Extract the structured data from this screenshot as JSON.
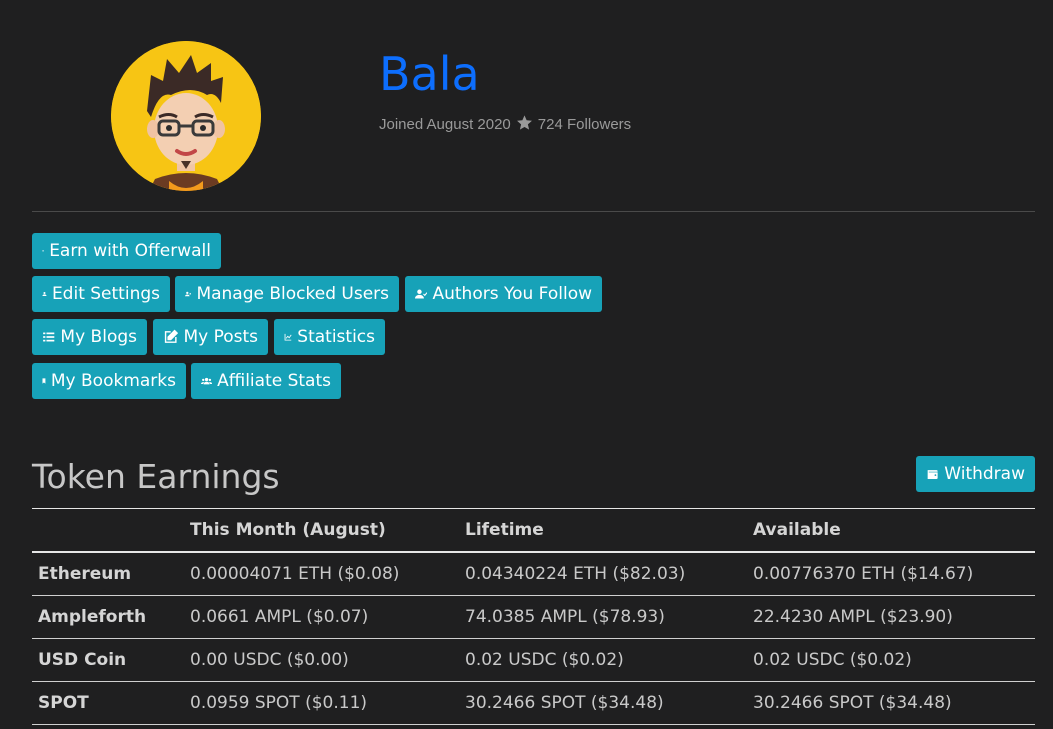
{
  "profile": {
    "name": "Bala",
    "joined": "Joined August 2020",
    "followers": "724 Followers"
  },
  "actions": {
    "earn_offerwall": "Earn with Offerwall",
    "edit_settings": "Edit Settings",
    "manage_blocked": "Manage Blocked Users",
    "authors_follow": "Authors You Follow",
    "my_blogs": "My Blogs",
    "my_posts": "My Posts",
    "statistics": "Statistics",
    "my_bookmarks": "My Bookmarks",
    "affiliate_stats": "Affiliate Stats"
  },
  "earnings": {
    "title": "Token Earnings",
    "withdraw": "Withdraw",
    "columns": [
      "",
      "This Month (August)",
      "Lifetime",
      "Available"
    ],
    "rows": [
      {
        "token": "Ethereum",
        "month": "0.00004071 ETH ($0.08)",
        "lifetime": "0.04340224 ETH ($82.03)",
        "available": "0.00776370 ETH ($14.67)"
      },
      {
        "token": "Ampleforth",
        "month": "0.0661 AMPL ($0.07)",
        "lifetime": "74.0385 AMPL ($78.93)",
        "available": "22.4230 AMPL ($23.90)"
      },
      {
        "token": "USD Coin",
        "month": "0.00 USDC ($0.00)",
        "lifetime": "0.02 USDC ($0.02)",
        "available": "0.02 USDC ($0.02)"
      },
      {
        "token": "SPOT",
        "month": "0.0959 SPOT ($0.11)",
        "lifetime": "30.2466 SPOT ($34.48)",
        "available": "30.2466 SPOT ($34.48)"
      }
    ]
  },
  "colors": {
    "accent": "#17a2b8",
    "name": "#0d6efd",
    "background": "#1f1f20"
  },
  "icons": {
    "star": "star-icon",
    "coins": "coins-icon",
    "user": "user-icon",
    "user_x": "user-times-icon",
    "user_check": "user-check-icon",
    "list": "list-icon",
    "edit": "edit-icon",
    "chart": "chart-line-icon",
    "bookmark": "bookmark-icon",
    "users": "users-icon",
    "wallet": "wallet-icon"
  }
}
